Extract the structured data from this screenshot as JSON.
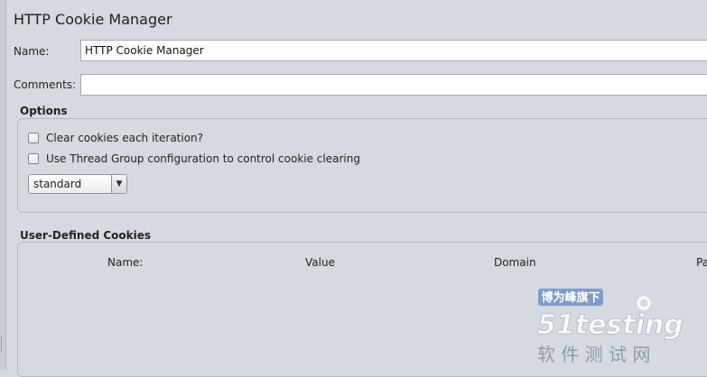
{
  "page": {
    "title": "HTTP Cookie Manager"
  },
  "form": {
    "name_label": "Name:",
    "name_value": "HTTP Cookie Manager",
    "comments_label": "Comments:",
    "comments_value": ""
  },
  "options": {
    "title": "Options",
    "clear_each_iteration": {
      "label": "Clear cookies each iteration?",
      "checked": false
    },
    "use_thread_group": {
      "label": "Use Thread Group configuration to control cookie clearing",
      "checked": false
    },
    "policy": {
      "selected": "standard"
    }
  },
  "cookies": {
    "title": "User-Defined Cookies",
    "columns": [
      "Name:",
      "Value",
      "Domain",
      "Pa"
    ],
    "rows": []
  },
  "watermark": {
    "badge": "博为峰旗下",
    "logo_text": "51testing",
    "subtitle": "软 件 测 试 网"
  },
  "colors": {
    "background": "#d6d9df",
    "watermark_blue": "#4f7fc9",
    "watermark_orange": "#f0961e"
  }
}
